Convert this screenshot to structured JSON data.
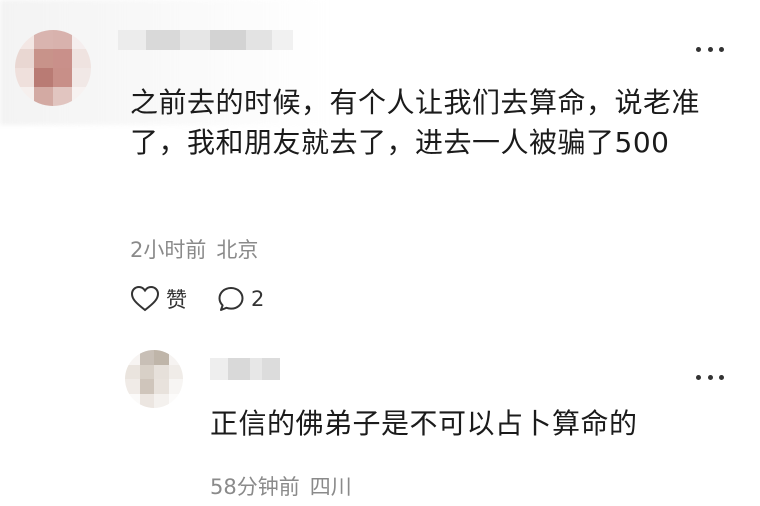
{
  "comments": [
    {
      "text": "之前去的时候，有个人让我们去算命，说老准了，我和朋友就去了，进去一人被骗了500",
      "time": "2小时前",
      "location": "北京",
      "actions": {
        "like_label": "赞",
        "reply_count": "2"
      }
    },
    {
      "text": "正信的佛弟子是不可以占卜算命的",
      "time": "58分钟前",
      "location": "四川"
    }
  ],
  "icons": {
    "like": "heart-outline-icon",
    "reply": "speech-bubble-icon",
    "more": "more-dots-icon"
  },
  "colors": {
    "text_primary": "#1b1b1b",
    "text_meta": "#8a8a8a"
  }
}
